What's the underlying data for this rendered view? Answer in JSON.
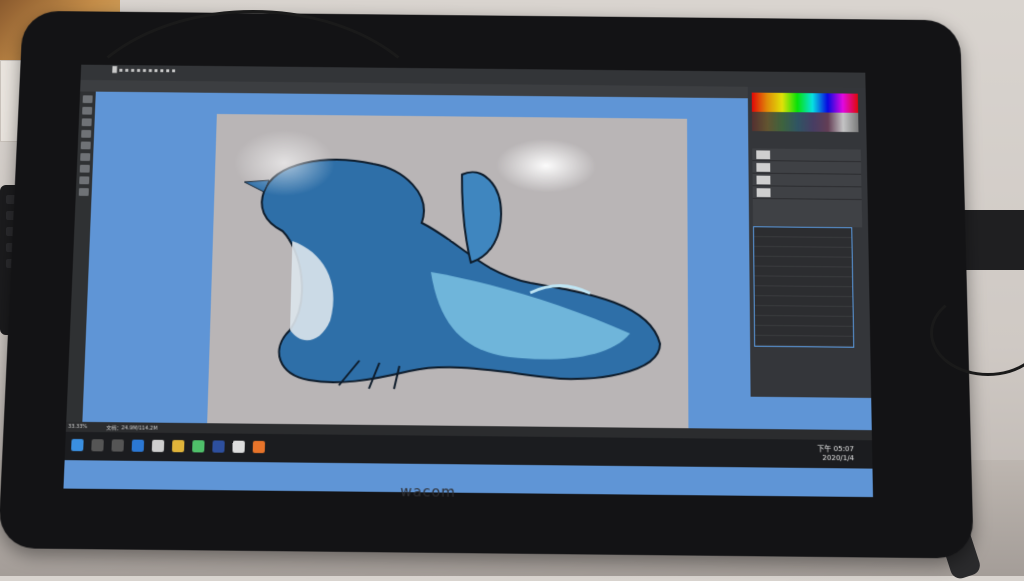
{
  "brand": "wacom",
  "statusbar": {
    "zoom": "33.33%",
    "doc": "文档：24.9M/114.2M"
  },
  "clock": {
    "time": "下午 05:07",
    "date": "2020/1/4"
  },
  "colors": {
    "screen_bg": "#5f95d6",
    "canvas": "#b9b5b6",
    "creature_main": "#2e6fa8",
    "creature_light": "#7fc7e6"
  }
}
